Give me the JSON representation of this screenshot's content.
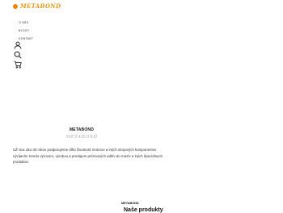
{
  "header": {
    "logo_text": "METABOND",
    "logo_color": "#e39a1c"
  },
  "nav": {
    "items": [
      {
        "label": "O NÁS"
      },
      {
        "label": "BLOGY"
      },
      {
        "label": "KONTAKT"
      }
    ]
  },
  "icons": [
    "user-icon",
    "search-icon",
    "cart-icon"
  ],
  "hero": {
    "brand_title": "METABOND",
    "brand_sub": "METABOND",
    "description": "UŽ viac ako 30 rokov podporujeme dlhú životnosť motorov a iných strojových komponentov vývíjaním trendu výrovom, výrobou a predajom prémiových aditív do mazív a iných špeciálnych produktov"
  },
  "products": {
    "label": "METABOND",
    "heading": "Naše produkty"
  }
}
